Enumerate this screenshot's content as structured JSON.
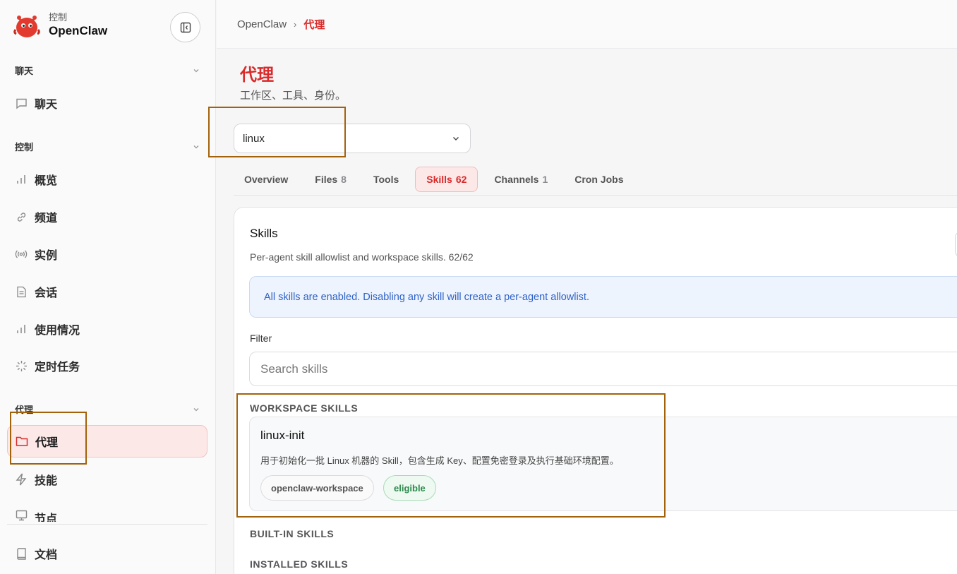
{
  "brand": {
    "sub": "控制",
    "title": "OpenClaw"
  },
  "sidebar": {
    "sections": [
      {
        "label": "聊天"
      },
      {
        "label": "控制"
      },
      {
        "label": "代理"
      }
    ],
    "items": [
      {
        "label": "聊天",
        "icon": "message-icon"
      },
      {
        "label": "概览",
        "icon": "bar-chart-icon"
      },
      {
        "label": "频道",
        "icon": "link-icon"
      },
      {
        "label": "实例",
        "icon": "broadcast-icon"
      },
      {
        "label": "会话",
        "icon": "document-icon"
      },
      {
        "label": "使用情况",
        "icon": "bar-chart-icon"
      },
      {
        "label": "定时任务",
        "icon": "loader-icon"
      },
      {
        "label": "代理",
        "icon": "folder-icon",
        "active": true
      },
      {
        "label": "技能",
        "icon": "zap-icon"
      },
      {
        "label": "节点",
        "icon": "monitor-icon"
      },
      {
        "label": "文档",
        "icon": "book-icon"
      }
    ]
  },
  "breadcrumb": {
    "root": "OpenClaw",
    "separator": "›",
    "current": "代理"
  },
  "page": {
    "title": "代理",
    "subtitle": "工作区、工具、身份。"
  },
  "agent_select": {
    "value": "linux"
  },
  "tabs": [
    {
      "label": "Overview",
      "count": ""
    },
    {
      "label": "Files",
      "count": "8"
    },
    {
      "label": "Tools",
      "count": ""
    },
    {
      "label": "Skills",
      "count": "62",
      "active": true
    },
    {
      "label": "Channels",
      "count": "1"
    },
    {
      "label": "Cron Jobs",
      "count": ""
    }
  ],
  "skills_panel": {
    "title": "Skills",
    "description": "Per-agent skill allowlist and workspace skills. 62/62",
    "info": "All skills are enabled. Disabling any skill will create a per-agent allowlist.",
    "filter_label": "Filter",
    "filter_placeholder": "Search skills",
    "groups": {
      "workspace": "WORKSPACE SKILLS",
      "builtin": "BUILT-IN SKILLS",
      "installed": "INSTALLED SKILLS"
    },
    "workspace_skill": {
      "name": "linux-init",
      "description": "用于初始化一批 Linux 机器的 Skill，包含生成 Key、配置免密登录及执行基础环境配置。",
      "source": "openclaw-workspace",
      "status": "eligible"
    }
  },
  "colors": {
    "accent": "#d92b2b",
    "info": "#2f62c8",
    "eligible": "#2e8b4f",
    "annotation": "#a2620c"
  }
}
